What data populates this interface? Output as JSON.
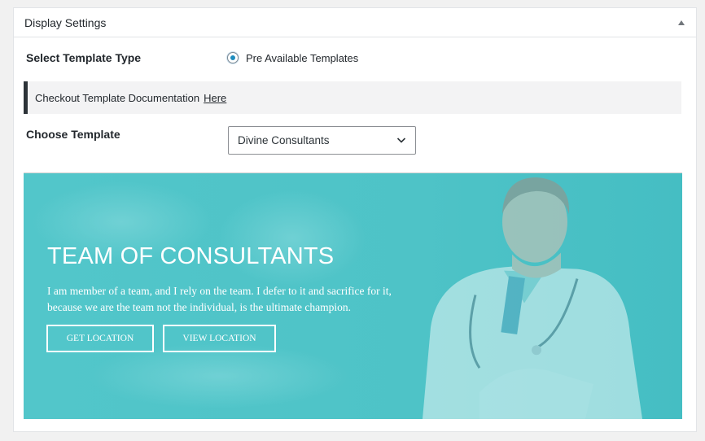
{
  "panel": {
    "title": "Display Settings"
  },
  "template_type": {
    "label": "Select Template Type",
    "option": "Pre Available Templates",
    "selected": true
  },
  "notice": {
    "text": "Checkout Template Documentation",
    "link": "Here"
  },
  "choose_template": {
    "label": "Choose Template",
    "selected": "Divine Consultants"
  },
  "preview": {
    "title": "TEAM OF CONSULTANTS",
    "line1": "I am member of a team, and I rely on the team. I defer to it and sacrifice for it,",
    "line2": "because we are the team not the individual, is the ultimate champion.",
    "button_get": "GET LOCATION",
    "button_view": "VIEW LOCATION",
    "overlay_color": "#4cc4c8"
  },
  "icons": {
    "collapse": "triangle-up-icon",
    "dropdown": "chevron-down-icon"
  }
}
